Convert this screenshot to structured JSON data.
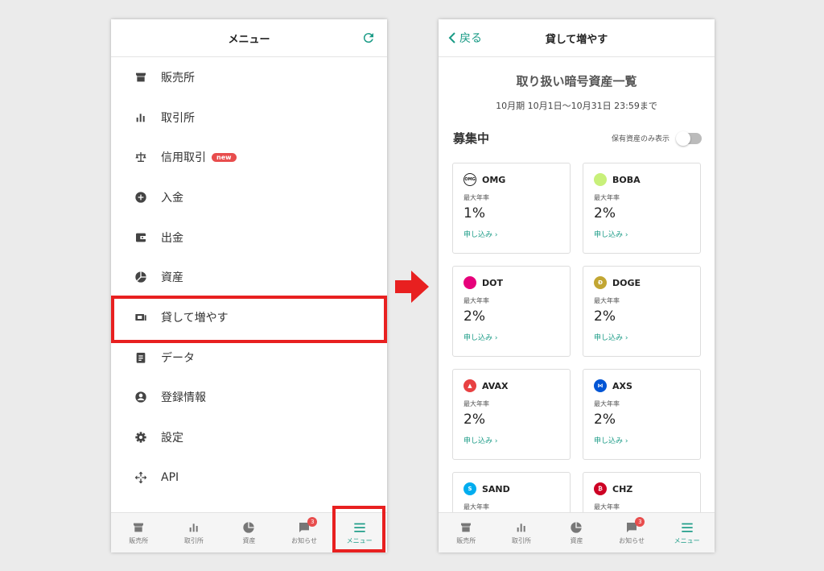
{
  "left_screen": {
    "title": "メニュー",
    "menu_items": [
      {
        "label": "販売所",
        "icon": "store-icon"
      },
      {
        "label": "取引所",
        "icon": "bar-chart-icon"
      },
      {
        "label": "信用取引",
        "icon": "scale-icon",
        "badge": "new"
      },
      {
        "label": "入金",
        "icon": "plus-circle-icon"
      },
      {
        "label": "出金",
        "icon": "wallet-icon"
      },
      {
        "label": "資産",
        "icon": "pie-chart-icon"
      },
      {
        "label": "貸して増やす",
        "icon": "lend-icon"
      },
      {
        "label": "データ",
        "icon": "clipboard-icon"
      },
      {
        "label": "登録情報",
        "icon": "account-icon"
      },
      {
        "label": "設定",
        "icon": "gear-icon"
      },
      {
        "label": "API",
        "icon": "api-icon"
      }
    ]
  },
  "tabbar": {
    "tabs": [
      {
        "label": "販売所",
        "icon": "store-icon"
      },
      {
        "label": "取引所",
        "icon": "bar-chart-icon"
      },
      {
        "label": "資産",
        "icon": "pie-chart-icon"
      },
      {
        "label": "お知らせ",
        "icon": "chat-icon",
        "count": "3"
      },
      {
        "label": "メニュー",
        "icon": "menu-icon"
      }
    ]
  },
  "right_screen": {
    "back_label": "戻る",
    "title": "貸して増やす",
    "section_title": "取り扱い暗号資産一覧",
    "period": "10月期 10月1日〜10月31日 23:59まで",
    "recruit_title": "募集中",
    "toggle_label": "保有資産のみ表示",
    "rate_label": "最大年率",
    "apply_label": "申し込み ›",
    "cards": [
      {
        "symbol": "OMG",
        "rate": "1%",
        "color": "#ffffff",
        "mark": "OMG"
      },
      {
        "symbol": "BOBA",
        "rate": "2%",
        "color": "#c8f07a",
        "mark": ""
      },
      {
        "symbol": "DOT",
        "rate": "2%",
        "color": "#e6007a",
        "mark": ""
      },
      {
        "symbol": "DOGE",
        "rate": "2%",
        "color": "#c2a633",
        "mark": "Ð"
      },
      {
        "symbol": "AVAX",
        "rate": "2%",
        "color": "#e84142",
        "mark": "▲"
      },
      {
        "symbol": "AXS",
        "rate": "2%",
        "color": "#0055d5",
        "mark": "⋈"
      },
      {
        "symbol": "SAND",
        "rate": "",
        "color": "#00adef",
        "mark": "S"
      },
      {
        "symbol": "CHZ",
        "rate": "",
        "color": "#cd0124",
        "mark": "₿"
      }
    ]
  },
  "colors": {
    "accent": "#1a9b86",
    "highlight": "#e82020",
    "badge": "#e84d4d"
  }
}
